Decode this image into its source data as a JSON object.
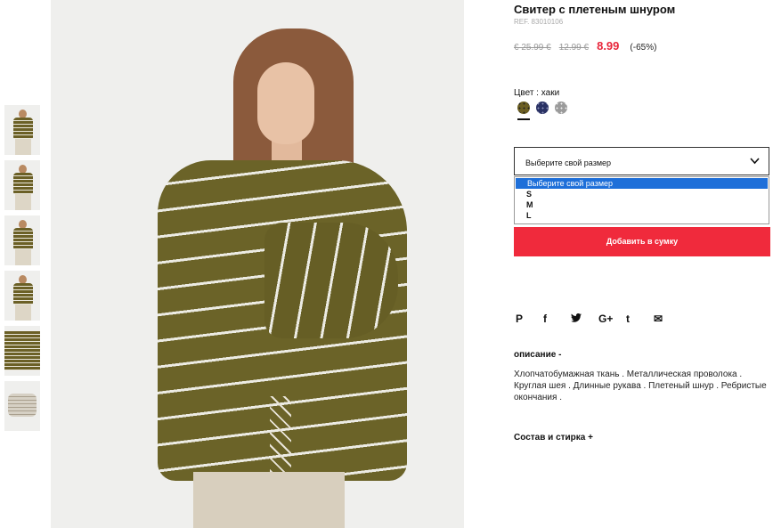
{
  "thumbnails": [
    "thumb-1",
    "thumb-2",
    "thumb-3",
    "thumb-4",
    "thumb-5",
    "thumb-6"
  ],
  "product": {
    "title": "Свитер с плетеным шнуром",
    "ref": "REF. 83010106",
    "price_original": "€ 25.99 €",
    "price_previous": "12.99 €",
    "price_current": "8.99",
    "discount": "(-65%)"
  },
  "color": {
    "label": "Цвет : хаки",
    "swatches": [
      "khaki-swatch",
      "navy-swatch",
      "grey-swatch"
    ]
  },
  "size": {
    "select_label": "Выберите свой размер",
    "options": [
      "Выберите свой размер",
      "S",
      "M",
      "L"
    ]
  },
  "actions": {
    "add_to_bag": "Добавить в сумку"
  },
  "social": {
    "pinterest": "P",
    "facebook": "f",
    "twitter": "t",
    "google_plus": "G+",
    "tumblr": "t",
    "email": "✉"
  },
  "description": {
    "heading": "описание -",
    "text": "Хлопчатобумажная ткань . Металлическая проволока . Круглая шея . Длинные рукава . Плетеный шнур . Ребристые окончания ."
  },
  "composition": {
    "heading": "Состав и стирка +"
  },
  "colors": {
    "accent": "#f02a3c",
    "price_red": "#e8273c",
    "select_blue": "#1e6fd9"
  }
}
